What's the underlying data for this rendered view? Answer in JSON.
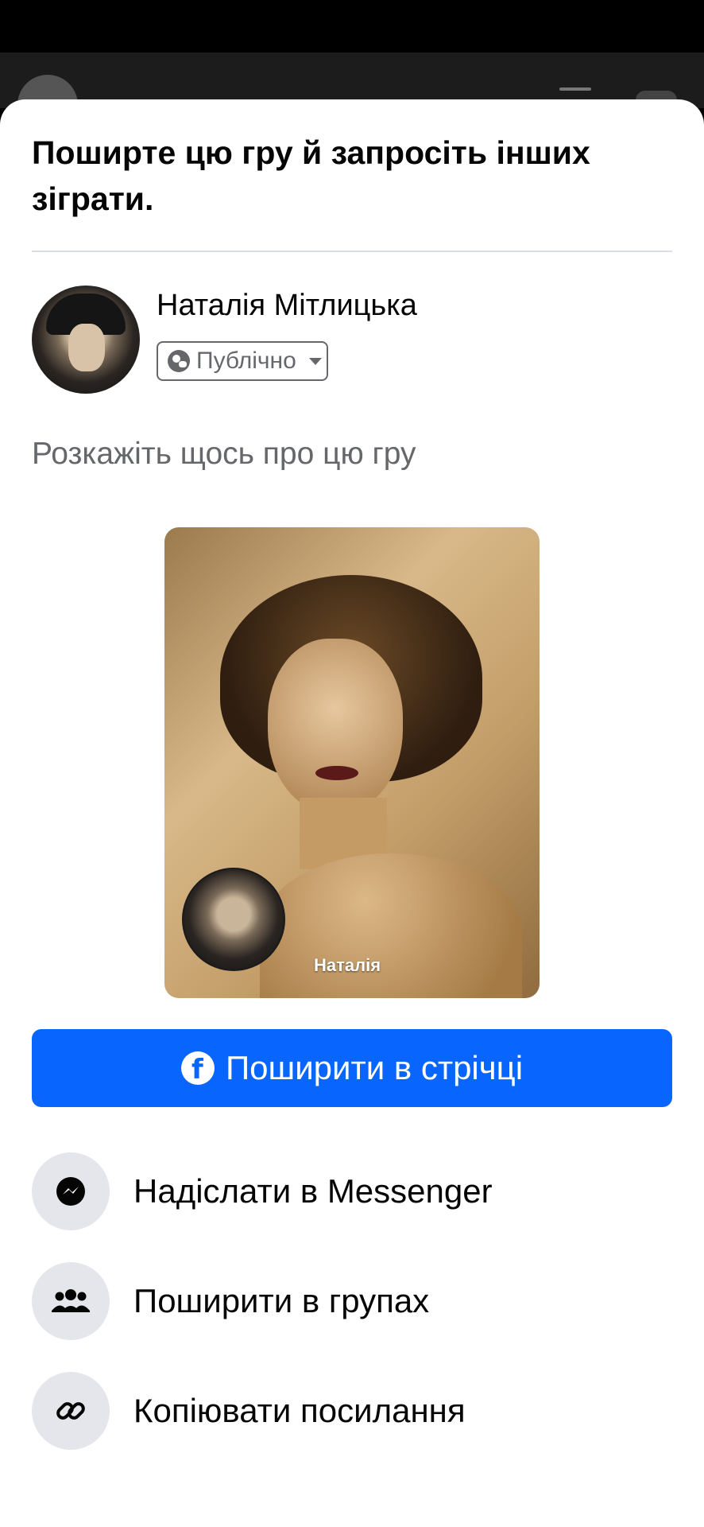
{
  "sheet": {
    "title": "Поширте цю гру й запросіть інших зіграти.",
    "user": {
      "name": "Наталія Мітлицька",
      "privacy_label": "Публічно"
    },
    "composer_placeholder": "Розкажіть щось про цю гру",
    "game_card": {
      "player_name": "Наталія"
    },
    "primary_action": {
      "label": "Поширити в стрічці",
      "color": "#0866ff"
    },
    "options": [
      {
        "label": "Надіслати в Messenger",
        "icon": "messenger-icon"
      },
      {
        "label": "Поширити в групах",
        "icon": "groups-icon"
      },
      {
        "label": "Копіювати посилання",
        "icon": "link-icon"
      }
    ]
  }
}
